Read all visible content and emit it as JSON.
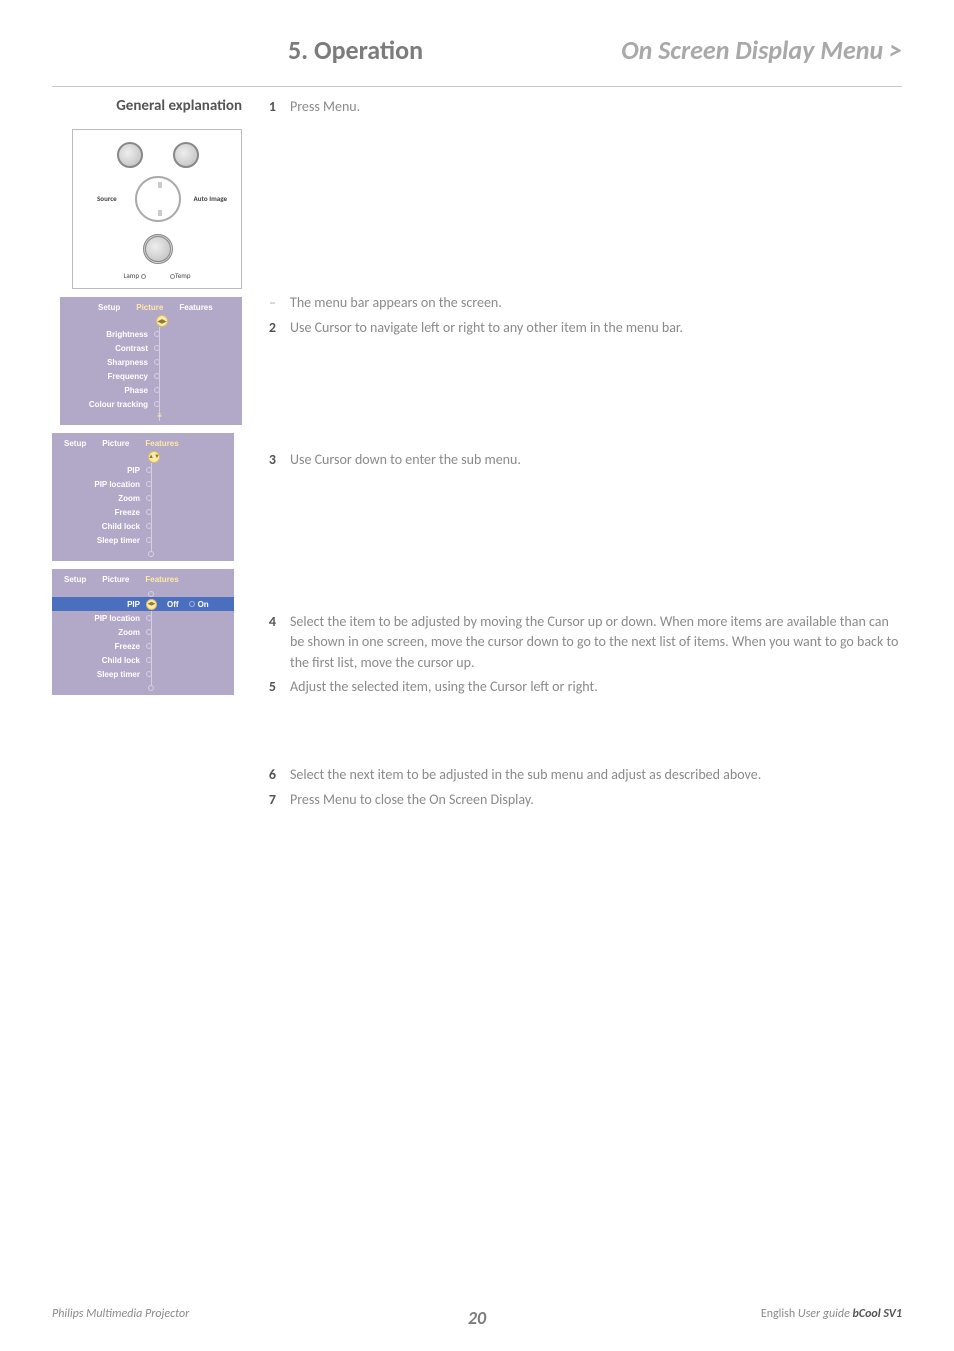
{
  "header": {
    "section": "5. Operation",
    "breadcrumb": "On Screen Display Menu >"
  },
  "subhead": "General explanation",
  "remote": {
    "source": "Source",
    "autoimage": "Auto Image",
    "lamp": "Lamp",
    "temp": "Temp"
  },
  "osd1": {
    "tabs": [
      "Setup",
      "Picture",
      "Features"
    ],
    "active": 1,
    "items": [
      "Brightness",
      "Contrast",
      "Sharpness",
      "Frequency",
      "Phase",
      "Colour tracking"
    ]
  },
  "osd2": {
    "tabs": [
      "Setup",
      "Picture",
      "Features"
    ],
    "active": 2,
    "items": [
      "PIP",
      "PIP location",
      "Zoom",
      "Freeze",
      "Child lock",
      "Sleep timer"
    ]
  },
  "osd3": {
    "tabs": [
      "Setup",
      "Picture",
      "Features"
    ],
    "active": 2,
    "items": [
      "PIP",
      "PIP location",
      "Zoom",
      "Freeze",
      "Child lock",
      "Sleep timer"
    ],
    "highlight_index": 0,
    "options": [
      "Off",
      "On"
    ]
  },
  "steps": {
    "s1": "Press Menu.",
    "dash": "The menu bar appears on the screen.",
    "s2": "Use Cursor to navigate left or right to any other item in the menu bar.",
    "s3": "Use Cursor down to enter the sub menu.",
    "s4": "Select the item to be adjusted by moving the Cursor up or down. When more items are available than can be shown in one screen, move the cursor down to go to the next list of items. When you want to go back to the first list, move the cursor up.",
    "s5": "Adjust the selected item, using the Cursor left or right.",
    "s6": "Select the next item to be adjusted in the sub menu and adjust as described above.",
    "s7": "Press Menu to close the On Screen Display."
  },
  "footer": {
    "left": "Philips Multimedia Projector",
    "page": "20",
    "lang": "English",
    "guide": "User guide",
    "model": "bCool SV1"
  }
}
